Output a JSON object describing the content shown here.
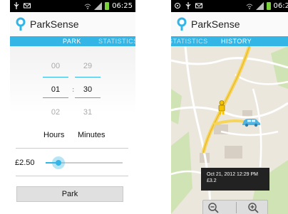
{
  "left_screen": {
    "status": {
      "time": "06:25"
    },
    "app": {
      "title": "ParkSense"
    },
    "tabs": {
      "park": "PARK",
      "statistics": "STATISTICS"
    },
    "picker": {
      "hours": {
        "prev": "00",
        "current": "01",
        "next": "02"
      },
      "minutes": {
        "prev": "29",
        "current": "30",
        "next": "31"
      },
      "separator": ":",
      "hours_label": "Hours",
      "minutes_label": "Minutes"
    },
    "price": "£2.50",
    "slider_fraction": 0.17,
    "park_button": "Park"
  },
  "right_screen": {
    "status": {
      "time": "06:2"
    },
    "app": {
      "title": "ParkSense"
    },
    "tabs": {
      "statistics": "STATISTICS",
      "history": "HISTORY"
    },
    "map": {
      "tooltip_line1": "Oct 21, 2012 12:29 PM",
      "tooltip_line2": "£3.2"
    }
  },
  "colors": {
    "accent": "#33b5e5",
    "status_bar": "#000000",
    "tooltip": "#222222"
  },
  "icons": [
    "usb-icon",
    "mail-icon",
    "location-icon",
    "wifi-icon",
    "signal-icon",
    "battery-icon",
    "parking-meter-icon",
    "person-marker-icon",
    "car-marker-icon",
    "zoom-out-icon",
    "zoom-in-icon"
  ]
}
